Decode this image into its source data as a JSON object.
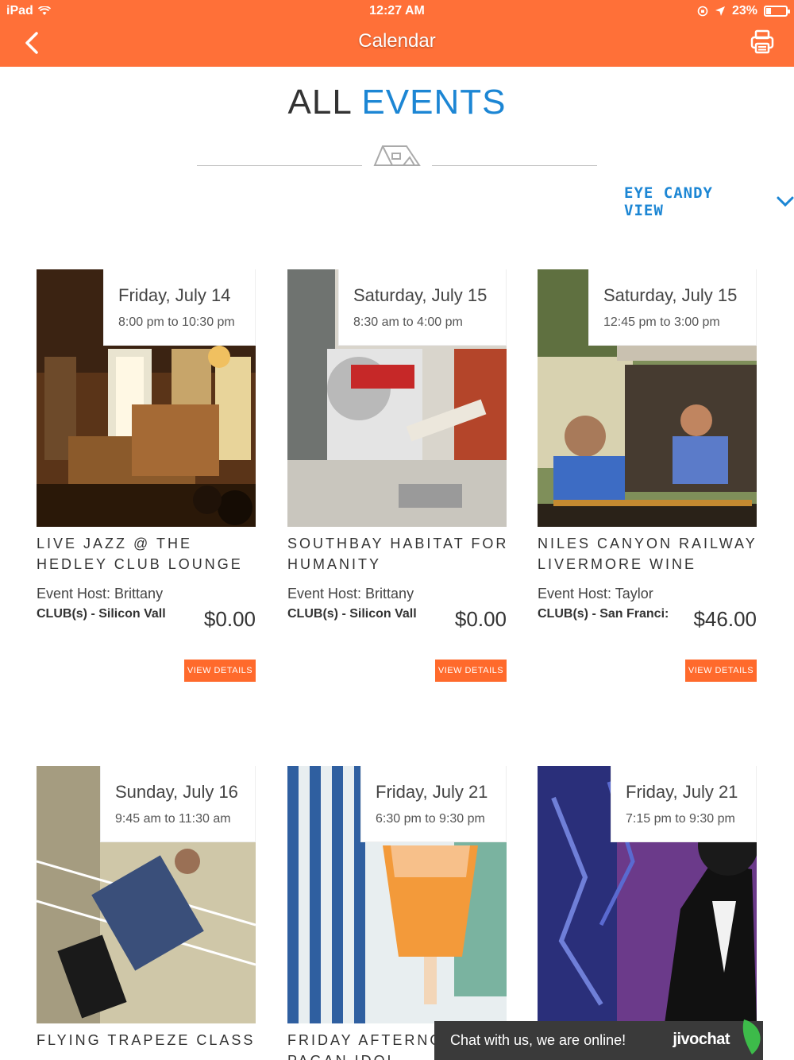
{
  "status_bar": {
    "device": "iPad",
    "time": "12:27 AM",
    "battery": "23%",
    "battery_level": 0.23
  },
  "nav": {
    "title": "Calendar"
  },
  "header": {
    "title_part1": "ALL",
    "title_part2": "EVENTS",
    "view_toggle": "EYE CANDY VIEW"
  },
  "events": [
    {
      "date": "Friday, July 14",
      "time": "8:00 pm to 10:30 pm",
      "title": "LIVE JAZZ @ THE HEDLEY CLUB LOUNGE",
      "host": "Event Host: Brittany",
      "club": "CLUB(s) - Silicon Vall",
      "price": "$0.00",
      "button": "VIEW DETAILS"
    },
    {
      "date": "Saturday, July 15",
      "time": "8:30 am to 4:00 pm",
      "title": "SOUTHBAY HABITAT FOR HUMANITY",
      "host": "Event Host: Brittany",
      "club": "CLUB(s) - Silicon Vall",
      "price": "$0.00",
      "button": "VIEW DETAILS"
    },
    {
      "date": "Saturday, July 15",
      "time": "12:45 pm to 3:00 pm",
      "title": "NILES CANYON RAILWAY LIVERMORE WINE",
      "host": "Event Host: Taylor",
      "club": "CLUB(s) - San Franci:",
      "price": "$46.00",
      "button": "VIEW DETAILS"
    },
    {
      "date": "Sunday, July 16",
      "time": "9:45 am to 11:30 am",
      "title": "FLYING TRAPEZE CLASS"
    },
    {
      "date": "Friday, July 21",
      "time": "6:30 pm to 9:30 pm",
      "title": "FRIDAY AFTERNOO @ PAGAN IDOL"
    },
    {
      "date": "Friday, July 21",
      "time": "7:15 pm to 9:30 pm"
    }
  ],
  "chat": {
    "message": "Chat with us, we are online!",
    "brand": "jivochat"
  },
  "colors": {
    "accent_orange": "#ff7038",
    "accent_blue": "#1c86d4",
    "button_orange": "#ff6a2c"
  }
}
